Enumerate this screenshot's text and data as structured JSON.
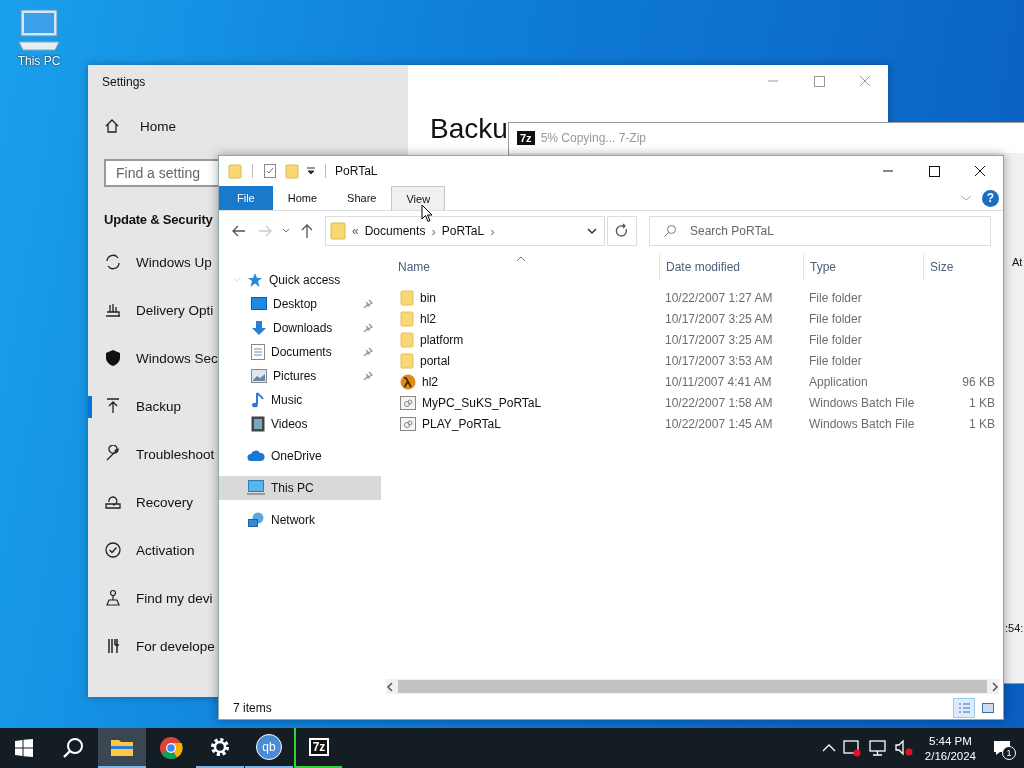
{
  "desktop_icons": [
    {
      "label": "This PC"
    }
  ],
  "settings": {
    "title": "Settings",
    "heading": "Backu",
    "home": "Home",
    "search": {
      "placeholder": "Find a setting"
    },
    "section": "Update & Security",
    "items": [
      {
        "label": "Windows Up",
        "selected": false
      },
      {
        "label": "Delivery Opti",
        "selected": false
      },
      {
        "label": "Windows Sec",
        "selected": false
      },
      {
        "label": "Backup",
        "selected": true
      },
      {
        "label": "Troubleshoot",
        "selected": false
      },
      {
        "label": "Recovery",
        "selected": false
      },
      {
        "label": "Activation",
        "selected": false
      },
      {
        "label": "Find my devi",
        "selected": false
      },
      {
        "label": "For develope",
        "selected": false
      }
    ]
  },
  "zip_window": {
    "icon_label": "7z",
    "title": "5% Copying... 7-Zip",
    "fragments": [
      "At",
      ":54:"
    ]
  },
  "explorer": {
    "title": "PoRTaL",
    "ribbon_tabs": [
      {
        "label": "File",
        "kind": "file"
      },
      {
        "label": "Home",
        "kind": "tab",
        "hovered": false
      },
      {
        "label": "Share",
        "kind": "tab",
        "hovered": false
      },
      {
        "label": "View",
        "kind": "tab",
        "hovered": true
      }
    ],
    "help": "?",
    "address": {
      "overflow": "«",
      "crumbs": [
        "Documents",
        "PoRTaL"
      ],
      "separator": "›"
    },
    "search": {
      "placeholder": "Search PoRTaL"
    },
    "nav": [
      {
        "label": "Quick access",
        "kind": "star",
        "expanded": true,
        "selected": false,
        "children": [
          {
            "label": "Desktop",
            "kind": "desktop",
            "pinned": true,
            "selected": false
          },
          {
            "label": "Downloads",
            "kind": "downloads",
            "pinned": true,
            "selected": false
          },
          {
            "label": "Documents",
            "kind": "documents",
            "pinned": true,
            "selected": false
          },
          {
            "label": "Pictures",
            "kind": "pictures",
            "pinned": true,
            "selected": false
          },
          {
            "label": "Music",
            "kind": "music",
            "pinned": false,
            "selected": false
          },
          {
            "label": "Videos",
            "kind": "videos",
            "pinned": false,
            "selected": false
          }
        ]
      },
      {
        "label": "OneDrive",
        "kind": "cloud",
        "selected": false
      },
      {
        "label": "This PC",
        "kind": "pc",
        "selected": true
      },
      {
        "label": "Network",
        "kind": "network",
        "selected": false
      }
    ],
    "columns": [
      "Name",
      "Date modified",
      "Type",
      "Size"
    ],
    "files": [
      {
        "kind": "folder",
        "name": "bin",
        "date": "10/22/2007 1:27 AM",
        "type": "File folder"
      },
      {
        "kind": "folder",
        "name": "hl2",
        "date": "10/17/2007 3:25 AM",
        "type": "File folder"
      },
      {
        "kind": "folder",
        "name": "platform",
        "date": "10/17/2007 3:25 AM",
        "type": "File folder"
      },
      {
        "kind": "folder",
        "name": "portal",
        "date": "10/17/2007 3:53 AM",
        "type": "File folder"
      },
      {
        "kind": "app",
        "name": "hl2",
        "date": "10/11/2007 4:41 AM",
        "type": "Application",
        "size": "96 KB"
      },
      {
        "kind": "batch",
        "name": "MyPC_SuKS_PoRTaL",
        "date": "10/22/2007 1:58 AM",
        "type": "Windows Batch File",
        "size": "1 KB"
      },
      {
        "kind": "batch",
        "name": "PLAY_PoRTaL",
        "date": "10/22/2007 1:45 AM",
        "type": "Windows Batch File",
        "size": "1 KB"
      }
    ],
    "status": "7 items",
    "view_buttons": [
      {
        "kind": "details",
        "selected": true
      },
      {
        "kind": "tiles",
        "selected": false
      }
    ]
  },
  "taskbar": {
    "items": [
      {
        "kind": "start",
        "open": false,
        "selected": false
      },
      {
        "kind": "search",
        "open": false,
        "selected": false
      },
      {
        "kind": "explorer",
        "open": true,
        "selected": true
      },
      {
        "kind": "chrome",
        "open": false,
        "selected": false
      },
      {
        "kind": "settings",
        "open": true,
        "selected": false
      },
      {
        "kind": "qb",
        "label": "qb",
        "open": true,
        "selected": false
      },
      {
        "kind": "sevenzip",
        "label": "7z",
        "open": true,
        "selected": false,
        "progress": true
      }
    ],
    "time": "5:44 PM",
    "date": "2/16/2024",
    "notifications": "1"
  }
}
